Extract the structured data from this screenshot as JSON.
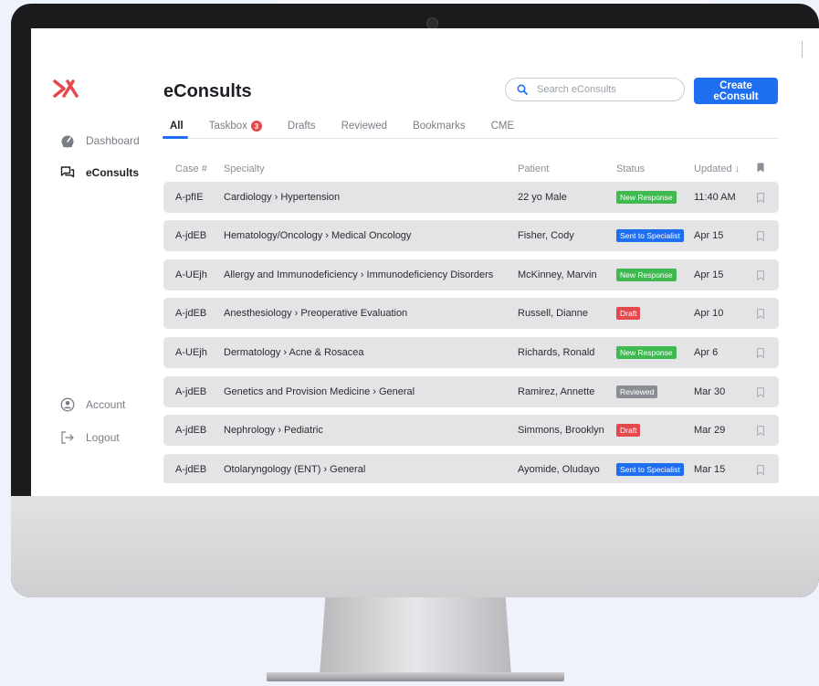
{
  "sidebar": {
    "items": [
      {
        "label": "Dashboard",
        "icon": "dashboard-gauge-icon",
        "active": false
      },
      {
        "label": "eConsults",
        "icon": "chat-bubbles-icon",
        "active": true
      },
      {
        "label": "Account",
        "icon": "user-circle-icon",
        "active": false
      },
      {
        "label": "Logout",
        "icon": "logout-arrow-icon",
        "active": false
      }
    ]
  },
  "header": {
    "title": "eConsults",
    "search_placeholder": "Search eConsults",
    "create_label": "Create eConsult"
  },
  "tabs": [
    {
      "label": "All",
      "active": true
    },
    {
      "label": "Taskbox",
      "badge": "3"
    },
    {
      "label": "Drafts"
    },
    {
      "label": "Reviewed"
    },
    {
      "label": "Bookmarks"
    },
    {
      "label": "CME"
    }
  ],
  "table": {
    "columns": [
      "Case #",
      "Specialty",
      "Patient",
      "Status",
      "Updated ↓"
    ],
    "rows": [
      {
        "case": "A-pfIE",
        "specialty": "Cardiology › Hypertension",
        "patient": "22 yo Male",
        "status": "New Response",
        "updated": "11:40 AM"
      },
      {
        "case": "A-jdEB",
        "specialty": "Hematology/Oncology › Medical Oncology",
        "patient": "Fisher, Cody",
        "status": "Sent to Specialist",
        "updated": "Apr 15"
      },
      {
        "case": "A-UEjh",
        "specialty": "Allergy and Immunodeficiency › Immunodeficiency Disorders",
        "patient": "McKinney, Marvin",
        "status": "New Response",
        "updated": "Apr 15"
      },
      {
        "case": "A-jdEB",
        "specialty": "Anesthesiology › Preoperative Evaluation",
        "patient": "Russell, Dianne",
        "status": "Draft",
        "updated": "Apr 10"
      },
      {
        "case": "A-UEjh",
        "specialty": "Dermatology  › Acne & Rosacea",
        "patient": "Richards, Ronald",
        "status": "New Response",
        "updated": "Apr 6"
      },
      {
        "case": "A-jdEB",
        "specialty": "Genetics and Provision Medicine › General",
        "patient": "Ramirez, Annette",
        "status": "Reviewed",
        "updated": "Mar 30"
      },
      {
        "case": "A-jdEB",
        "specialty": "Nephrology › Pediatric",
        "patient": "Simmons, Brooklyn",
        "status": "Draft",
        "updated": "Mar 29"
      },
      {
        "case": "A-jdEB",
        "specialty": "Otolaryngology (ENT) › General",
        "patient": "Ayomide, Oludayo",
        "status": "Sent to Specialist",
        "updated": "Mar 15"
      }
    ]
  },
  "colors": {
    "accent": "#1f6ff2",
    "logo": "#e5484d",
    "New Response": "#3fb950",
    "Sent to Specialist": "#1f6ff2",
    "Draft": "#e5484d",
    "Reviewed": "#8a8d93"
  }
}
